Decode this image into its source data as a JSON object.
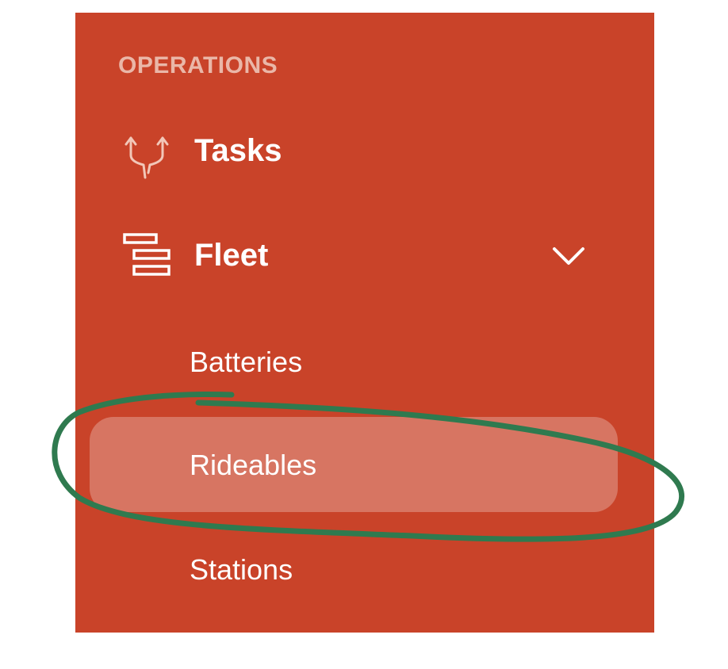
{
  "colors": {
    "sidebar_bg": "#c94329",
    "heading": "#eab7a8",
    "text": "#ffffff",
    "active_bg": "rgba(255,255,255,0.27)",
    "annotation": "#2f7a4f"
  },
  "sidebar": {
    "section_title": "OPERATIONS",
    "items": [
      {
        "label": "Tasks",
        "icon": "split-arrows-icon"
      },
      {
        "label": "Fleet",
        "icon": "fleet-stack-icon",
        "expanded": true,
        "children": [
          {
            "label": "Batteries",
            "active": false
          },
          {
            "label": "Rideables",
            "active": true
          },
          {
            "label": "Stations",
            "active": false
          }
        ]
      }
    ]
  }
}
